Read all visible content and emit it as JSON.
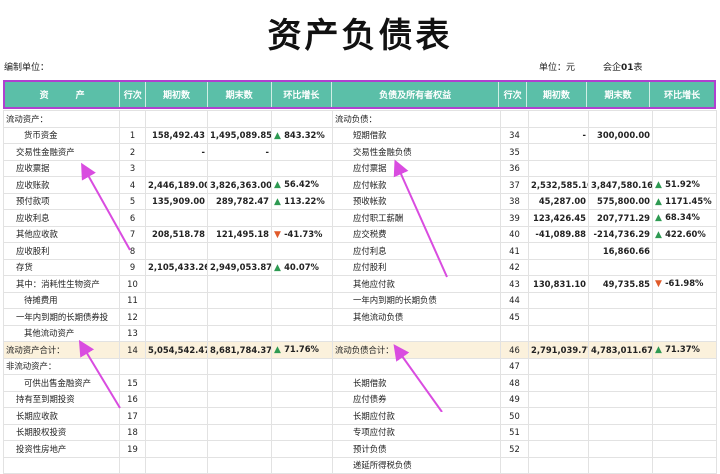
{
  "title": "资产负债表",
  "meta": {
    "unit_label": "编制单位：",
    "currency_label": "单位：元",
    "form_prefix": "会企",
    "form_code": "01",
    "form_suffix": "表"
  },
  "headers": [
    "资　　　产",
    "行次",
    "期初数",
    "期末数",
    "环比增长",
    "负债及所有者权益",
    "行次",
    "期初数",
    "期末数",
    "环比增长"
  ],
  "colors": {
    "header_bg": "#5bbfa8",
    "header_border": "#b040d0",
    "total_row_bg": "#fbf1dc",
    "up": "#2e9a52",
    "down": "#e05a2a",
    "annotation_arrow": "#d94ce0"
  },
  "rows": [
    {
      "l_name": "流动资产：",
      "l_ln": "",
      "l_open": "",
      "l_close": "",
      "l_dir": "",
      "l_pct": "",
      "r_name": "流动负债：",
      "r_ln": "",
      "r_open": "",
      "r_close": "",
      "r_dir": "",
      "r_pct": "",
      "l_ind": 0,
      "r_ind": 0
    },
    {
      "l_name": "货币资金",
      "l_ln": "1",
      "l_open": "158,492.43",
      "l_close": "1,495,089.85",
      "l_dir": "up",
      "l_pct": "843.32%",
      "r_name": "短期借款",
      "r_ln": "34",
      "r_open": "-",
      "r_close": "300,000.00",
      "r_dir": "",
      "r_pct": "",
      "l_ind": 2,
      "r_ind": 2
    },
    {
      "l_name": "交易性金融资产",
      "l_ln": "2",
      "l_open": "-",
      "l_close": "-",
      "l_dir": "",
      "l_pct": "",
      "r_name": "交易性金融负债",
      "r_ln": "35",
      "r_open": "",
      "r_close": "",
      "r_dir": "",
      "r_pct": "",
      "l_ind": 1,
      "r_ind": 2
    },
    {
      "l_name": "应收票据",
      "l_ln": "3",
      "l_open": "",
      "l_close": "",
      "l_dir": "",
      "l_pct": "",
      "r_name": "应付票据",
      "r_ln": "36",
      "r_open": "",
      "r_close": "",
      "r_dir": "",
      "r_pct": "",
      "l_ind": 1,
      "r_ind": 2
    },
    {
      "l_name": "应收账款",
      "l_ln": "4",
      "l_open": "2,446,189.00",
      "l_close": "3,826,363.00",
      "l_dir": "up",
      "l_pct": "56.42%",
      "r_name": "应付帐款",
      "r_ln": "37",
      "r_open": "2,532,585.10",
      "r_close": "3,847,580.16",
      "r_dir": "up",
      "r_pct": "51.92%",
      "l_ind": 1,
      "r_ind": 2
    },
    {
      "l_name": "预付款项",
      "l_ln": "5",
      "l_open": "135,909.00",
      "l_close": "289,782.47",
      "l_dir": "up",
      "l_pct": "113.22%",
      "r_name": "预收帐款",
      "r_ln": "38",
      "r_open": "45,287.00",
      "r_close": "575,800.00",
      "r_dir": "up",
      "r_pct": "1171.45%",
      "l_ind": 1,
      "r_ind": 2
    },
    {
      "l_name": "应收利息",
      "l_ln": "6",
      "l_open": "",
      "l_close": "",
      "l_dir": "",
      "l_pct": "",
      "r_name": "应付职工薪酬",
      "r_ln": "39",
      "r_open": "123,426.45",
      "r_close": "207,771.29",
      "r_dir": "up",
      "r_pct": "68.34%",
      "l_ind": 1,
      "r_ind": 2
    },
    {
      "l_name": "其他应收款",
      "l_ln": "7",
      "l_open": "208,518.78",
      "l_close": "121,495.18",
      "l_dir": "down",
      "l_pct": "-41.73%",
      "r_name": "应交税费",
      "r_ln": "40",
      "r_open": "-41,089.88",
      "r_close": "-214,736.29",
      "r_dir": "up",
      "r_pct": "422.60%",
      "l_ind": 1,
      "r_ind": 2
    },
    {
      "l_name": "应收股利",
      "l_ln": "8",
      "l_open": "",
      "l_close": "",
      "l_dir": "",
      "l_pct": "",
      "r_name": "应付利息",
      "r_ln": "41",
      "r_open": "",
      "r_close": "16,860.66",
      "r_dir": "",
      "r_pct": "",
      "l_ind": 1,
      "r_ind": 2
    },
    {
      "l_name": "存货",
      "l_ln": "9",
      "l_open": "2,105,433.26",
      "l_close": "2,949,053.87",
      "l_dir": "up",
      "l_pct": "40.07%",
      "r_name": "应付股利",
      "r_ln": "42",
      "r_open": "",
      "r_close": "",
      "r_dir": "",
      "r_pct": "",
      "l_ind": 1,
      "r_ind": 2
    },
    {
      "l_name": "其中：消耗性生物资产",
      "l_ln": "10",
      "l_open": "",
      "l_close": "",
      "l_dir": "",
      "l_pct": "",
      "r_name": "其他应付款",
      "r_ln": "43",
      "r_open": "130,831.10",
      "r_close": "49,735.85",
      "r_dir": "down",
      "r_pct": "-61.98%",
      "l_ind": 1,
      "r_ind": 2
    },
    {
      "l_name": "待摊费用",
      "l_ln": "11",
      "l_open": "",
      "l_close": "",
      "l_dir": "",
      "l_pct": "",
      "r_name": "一年内到期的长期负债",
      "r_ln": "44",
      "r_open": "",
      "r_close": "",
      "r_dir": "",
      "r_pct": "",
      "l_ind": 2,
      "r_ind": 2
    },
    {
      "l_name": "一年内到期的长期债券投",
      "l_ln": "12",
      "l_open": "",
      "l_close": "",
      "l_dir": "",
      "l_pct": "",
      "r_name": "其他流动负债",
      "r_ln": "45",
      "r_open": "",
      "r_close": "",
      "r_dir": "",
      "r_pct": "",
      "l_ind": 1,
      "r_ind": 2
    },
    {
      "l_name": "其他流动资产",
      "l_ln": "13",
      "l_open": "",
      "l_close": "",
      "l_dir": "",
      "l_pct": "",
      "r_name": "",
      "r_ln": "",
      "r_open": "",
      "r_close": "",
      "r_dir": "",
      "r_pct": "",
      "l_ind": 2,
      "r_ind": 0
    },
    {
      "l_name": "流动资产合计：",
      "l_ln": "14",
      "l_open": "5,054,542.47",
      "l_close": "8,681,784.37",
      "l_dir": "up",
      "l_pct": "71.76%",
      "r_name": "流动负债合计：",
      "r_ln": "46",
      "r_open": "2,791,039.77",
      "r_close": "4,783,011.67",
      "r_dir": "up",
      "r_pct": "71.37%",
      "l_ind": 0,
      "r_ind": 0,
      "total": true
    },
    {
      "l_name": "非流动资产：",
      "l_ln": "",
      "l_open": "",
      "l_close": "",
      "l_dir": "",
      "l_pct": "",
      "r_name": "",
      "r_ln": "47",
      "r_open": "",
      "r_close": "",
      "r_dir": "",
      "r_pct": "",
      "l_ind": 0,
      "r_ind": 0
    },
    {
      "l_name": "可供出售金融资产",
      "l_ln": "15",
      "l_open": "",
      "l_close": "",
      "l_dir": "",
      "l_pct": "",
      "r_name": "长期借款",
      "r_ln": "48",
      "r_open": "",
      "r_close": "",
      "r_dir": "",
      "r_pct": "",
      "l_ind": 2,
      "r_ind": 2
    },
    {
      "l_name": "持有至到期投资",
      "l_ln": "16",
      "l_open": "",
      "l_close": "",
      "l_dir": "",
      "l_pct": "",
      "r_name": "应付债券",
      "r_ln": "49",
      "r_open": "",
      "r_close": "",
      "r_dir": "",
      "r_pct": "",
      "l_ind": 1,
      "r_ind": 2
    },
    {
      "l_name": "长期应收款",
      "l_ln": "17",
      "l_open": "",
      "l_close": "",
      "l_dir": "",
      "l_pct": "",
      "r_name": "长期应付款",
      "r_ln": "50",
      "r_open": "",
      "r_close": "",
      "r_dir": "",
      "r_pct": "",
      "l_ind": 1,
      "r_ind": 2
    },
    {
      "l_name": "长期股权投资",
      "l_ln": "18",
      "l_open": "",
      "l_close": "",
      "l_dir": "",
      "l_pct": "",
      "r_name": "专项应付款",
      "r_ln": "51",
      "r_open": "",
      "r_close": "",
      "r_dir": "",
      "r_pct": "",
      "l_ind": 1,
      "r_ind": 2
    },
    {
      "l_name": "投资性房地产",
      "l_ln": "19",
      "l_open": "",
      "l_close": "",
      "l_dir": "",
      "l_pct": "",
      "r_name": "预计负债",
      "r_ln": "52",
      "r_open": "",
      "r_close": "",
      "r_dir": "",
      "r_pct": "",
      "l_ind": 1,
      "r_ind": 2
    },
    {
      "l_name": "",
      "l_ln": "",
      "l_open": "",
      "l_close": "",
      "l_dir": "",
      "l_pct": "",
      "r_name": "递延所得税负债",
      "r_ln": "",
      "r_open": "",
      "r_close": "",
      "r_dir": "",
      "r_pct": "",
      "l_ind": 0,
      "r_ind": 2
    }
  ]
}
